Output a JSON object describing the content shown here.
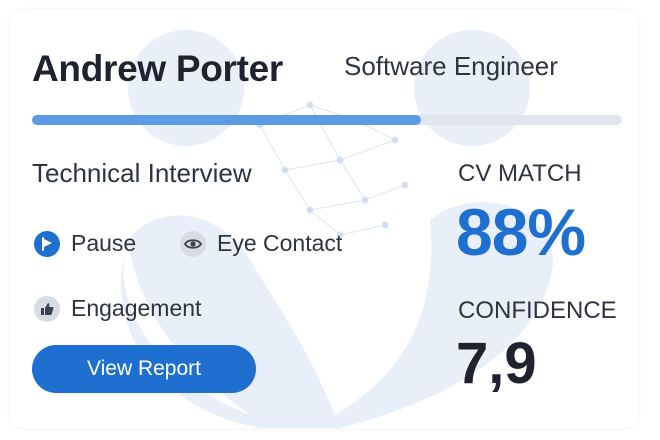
{
  "candidate": {
    "name": "Andrew Porter",
    "role": "Software Engineer"
  },
  "progress": {
    "fraction": 0.66
  },
  "interview": {
    "type": "Technical Interview",
    "metrics": [
      {
        "label": "Pause",
        "icon": "play-flag-icon"
      },
      {
        "label": "Eye Contact",
        "icon": "eye-icon"
      },
      {
        "label": "Engagement",
        "icon": "thumbs-up-icon"
      }
    ],
    "view_report_label": "View Report"
  },
  "stats": {
    "cv_match_label": "CV MATCH",
    "cv_match_value": "88%",
    "confidence_label": "CONFIDENCE",
    "confidence_value": "7,9"
  },
  "colors": {
    "accent": "#1f6fd0",
    "progress_fill": "#5a9be3",
    "progress_track": "#e1e6ee",
    "text_dark": "#1f2330",
    "background_art": "#e6eef8"
  }
}
